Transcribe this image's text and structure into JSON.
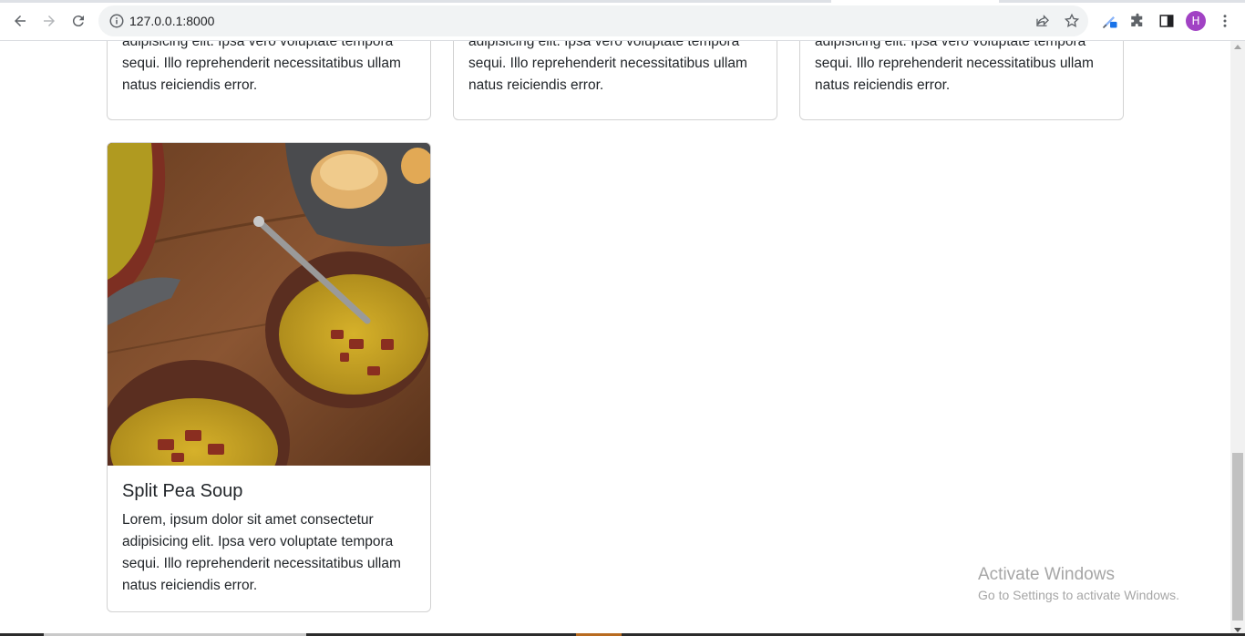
{
  "browser": {
    "url": "127.0.0.1:8000",
    "profile_initial": "H",
    "profile_color": "#a142c4"
  },
  "cards_top": [
    {
      "text_visible": "adipisicing elit. Ipsa vero voluptate tempora sequi. Illo reprehenderit necessitatibus ullam natus reiciendis error."
    },
    {
      "text_visible": "adipisicing elit. Ipsa vero voluptate tempora sequi. Illo reprehenderit necessitatibus ullam natus reiciendis error."
    },
    {
      "text_visible": "adipisicing elit. Ipsa vero voluptate tempora sequi. Illo reprehenderit necessitatibus ullam natus reiciendis error."
    }
  ],
  "card_main": {
    "title": "Split Pea Soup",
    "text": "Lorem, ipsum dolor sit amet consectetur adipisicing elit. Ipsa vero voluptate tempora sequi. Illo reprehenderit necessitatibus ullam natus reiciendis error."
  },
  "watermark": {
    "line1": "Activate Windows",
    "line2": "Go to Settings to activate Windows."
  },
  "icons": [
    "back-icon",
    "forward-icon",
    "reload-icon",
    "info-icon",
    "share-icon",
    "star-icon",
    "extension-pen-icon",
    "puzzle-icon",
    "side-panel-icon",
    "kebab-menu-icon"
  ]
}
